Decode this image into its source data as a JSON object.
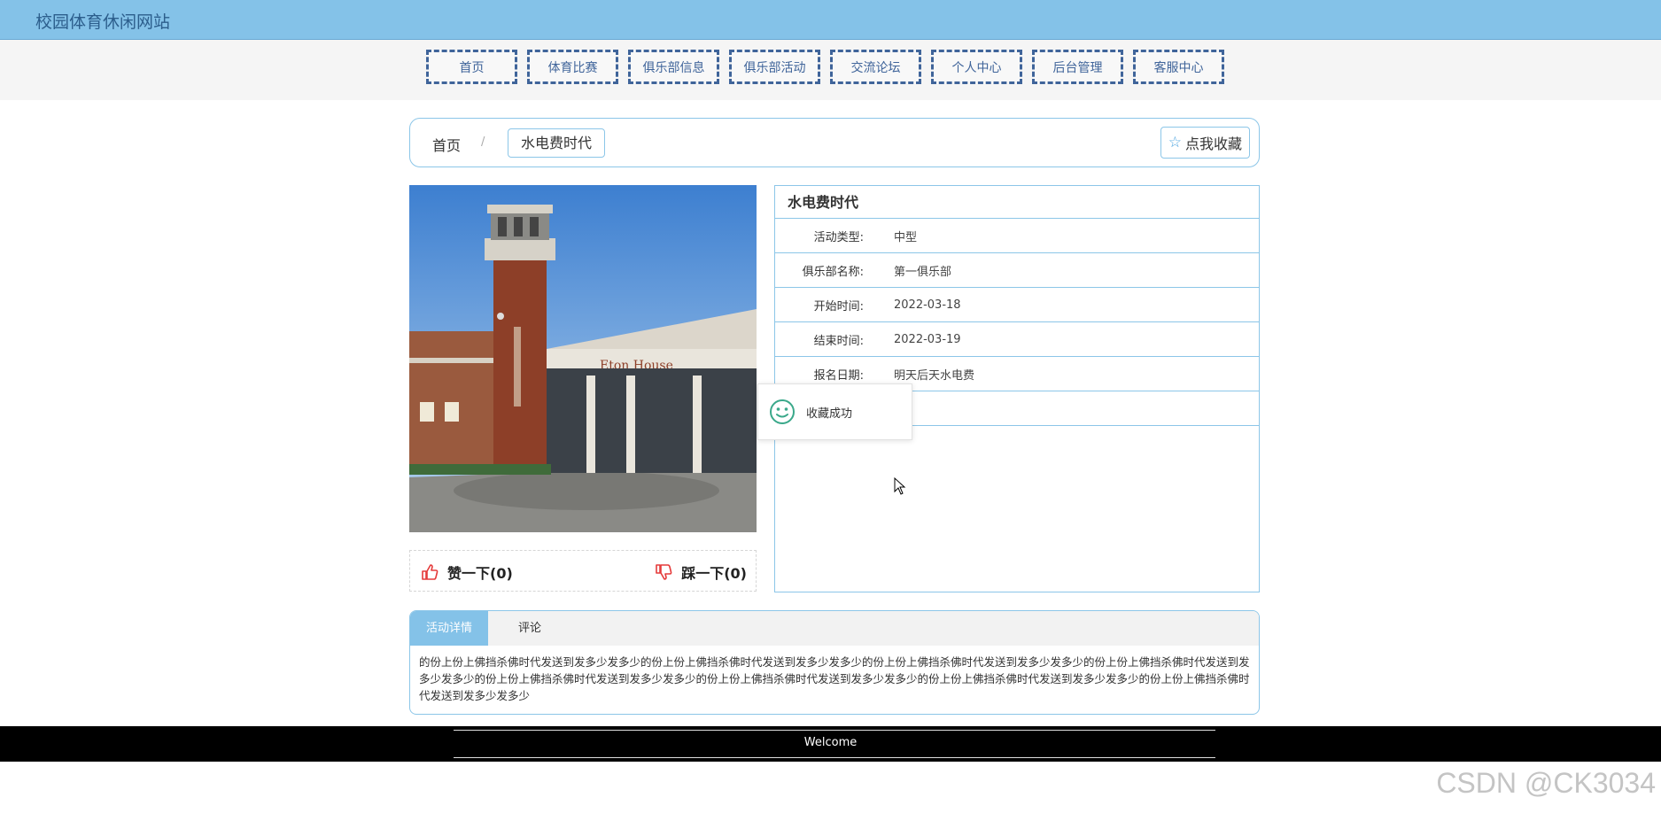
{
  "header": {
    "site_title": "校园体育休闲网站"
  },
  "nav": {
    "items": [
      "首页",
      "体育比赛",
      "俱乐部信息",
      "俱乐部活动",
      "交流论坛",
      "个人中心",
      "后台管理",
      "客服中心"
    ]
  },
  "breadcrumb": {
    "home": "首页",
    "separator": "/",
    "current": "水电费时代",
    "favorite_button": "点我收藏"
  },
  "photo": {
    "icon": "building-photo",
    "sign_text": "Eton House"
  },
  "votes": {
    "like_label": "赞一下(0)",
    "dislike_label": "踩一下(0)"
  },
  "details": {
    "title": "水电费时代",
    "rows": [
      {
        "label": "活动类型:",
        "value": "中型"
      },
      {
        "label": "俱乐部名称:",
        "value": "第一俱乐部"
      },
      {
        "label": "开始时间:",
        "value": "2022-03-18"
      },
      {
        "label": "结束时间:",
        "value": "2022-03-19"
      },
      {
        "label": "报名日期:",
        "value": "明天后天水电费"
      },
      {
        "label": "",
        "value": ""
      }
    ]
  },
  "toast": {
    "text": "收藏成功",
    "icon": "smiley-icon"
  },
  "tabs": {
    "active_label": "活动详情",
    "comment_label": "评论",
    "content": "的份上份上佛挡杀佛时代发送到发多少发多少的份上份上佛挡杀佛时代发送到发多少发多少的份上份上佛挡杀佛时代发送到发多少发多少的份上份上佛挡杀佛时代发送到发多少发多少的份上份上佛挡杀佛时代发送到发多少发多少的份上份上佛挡杀佛时代发送到发多少发多少的份上份上佛挡杀佛时代发送到发多少发多少的份上份上佛挡杀佛时代发送到发多少发多少"
  },
  "footer": {
    "text": "Welcome"
  },
  "watermark": "CSDN @CK3034",
  "colors": {
    "topbar": "#84c2e8",
    "nav_border": "#3f649a",
    "accent_border": "#8cc6e8",
    "thumb_red": "#e53b3b",
    "toast_green": "#3aa88a"
  }
}
